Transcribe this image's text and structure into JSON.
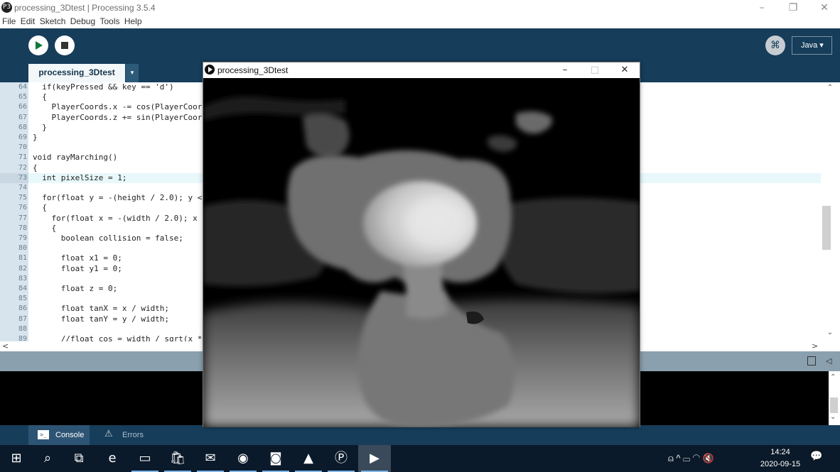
{
  "window": {
    "title": "processing_3Dtest | Processing 3.5.4",
    "logo_glyph": "P3",
    "minimize": "–",
    "restore": "❐",
    "close": "✕"
  },
  "menu": [
    "File",
    "Edit",
    "Sketch",
    "Debug",
    "Tools",
    "Help"
  ],
  "toolbar": {
    "debug_glyph": "⌘",
    "mode": "Java ▾"
  },
  "tab": {
    "name": "processing_3Dtest",
    "menu_glyph": "▾"
  },
  "editor": {
    "lines": [
      {
        "n": "64",
        "code": "  if(keyPressed && key == 'd')"
      },
      {
        "n": "65",
        "code": "  {"
      },
      {
        "n": "66",
        "code": "    PlayerCoords.x -= cos(PlayerCoor"
      },
      {
        "n": "67",
        "code": "    PlayerCoords.z += sin(PlayerCoor"
      },
      {
        "n": "68",
        "code": "  }"
      },
      {
        "n": "69",
        "code": "}"
      },
      {
        "n": "70",
        "code": ""
      },
      {
        "n": "71",
        "code": "void rayMarching()"
      },
      {
        "n": "72",
        "code": "{"
      },
      {
        "n": "73",
        "code": "  int pixelSize = 1;"
      },
      {
        "n": "74",
        "code": ""
      },
      {
        "n": "75",
        "code": "  for(float y = -(height / 2.0); y <"
      },
      {
        "n": "76",
        "code": "  {"
      },
      {
        "n": "77",
        "code": "    for(float x = -(width / 2.0); x"
      },
      {
        "n": "78",
        "code": "    {"
      },
      {
        "n": "79",
        "code": "      boolean collision = false;"
      },
      {
        "n": "80",
        "code": ""
      },
      {
        "n": "81",
        "code": "      float x1 = 0;"
      },
      {
        "n": "82",
        "code": "      float y1 = 0;"
      },
      {
        "n": "83",
        "code": ""
      },
      {
        "n": "84",
        "code": "      float z = 0;"
      },
      {
        "n": "85",
        "code": ""
      },
      {
        "n": "86",
        "code": "      float tanX = x / width;"
      },
      {
        "n": "87",
        "code": "      float tanY = y / width;"
      },
      {
        "n": "88",
        "code": ""
      },
      {
        "n": "89",
        "code": "      //float cos = width / sqrt(x *"
      }
    ],
    "current_line": "73"
  },
  "scroll": {
    "up": "⌃",
    "down": "⌄",
    "left": "<",
    "right": ">"
  },
  "status": {
    "copy_icon": "copy-icon",
    "collapse_glyph": "◁"
  },
  "console_tabs": {
    "console": "Console",
    "console_glyph": ">_",
    "errors": "Errors",
    "errors_glyph": "⚠"
  },
  "sketch": {
    "title": "processing_3Dtest",
    "minimize": "–",
    "maximize": "□",
    "close": "✕"
  },
  "taskbar": {
    "apps": [
      {
        "name": "start-icon",
        "glyph": "⊞"
      },
      {
        "name": "search-icon",
        "glyph": "⌕"
      },
      {
        "name": "task-view-icon",
        "glyph": "⧉"
      },
      {
        "name": "edge-icon",
        "glyph": "e"
      },
      {
        "name": "file-explorer-icon",
        "glyph": "▭"
      },
      {
        "name": "store-icon",
        "glyph": "🛍"
      },
      {
        "name": "mail-icon",
        "glyph": "✉"
      },
      {
        "name": "chrome-icon",
        "glyph": "◉"
      },
      {
        "name": "discord-icon",
        "glyph": "◙"
      },
      {
        "name": "photos-icon",
        "glyph": "▲"
      },
      {
        "name": "processing-icon",
        "glyph": "Ⓟ"
      },
      {
        "name": "sketch-run-icon",
        "glyph": "▶"
      }
    ],
    "tray": "⍝   ^   ▭   ◠   🔇",
    "time": "14:24",
    "date": "2020-09-15",
    "notifications_glyph": "💬"
  }
}
